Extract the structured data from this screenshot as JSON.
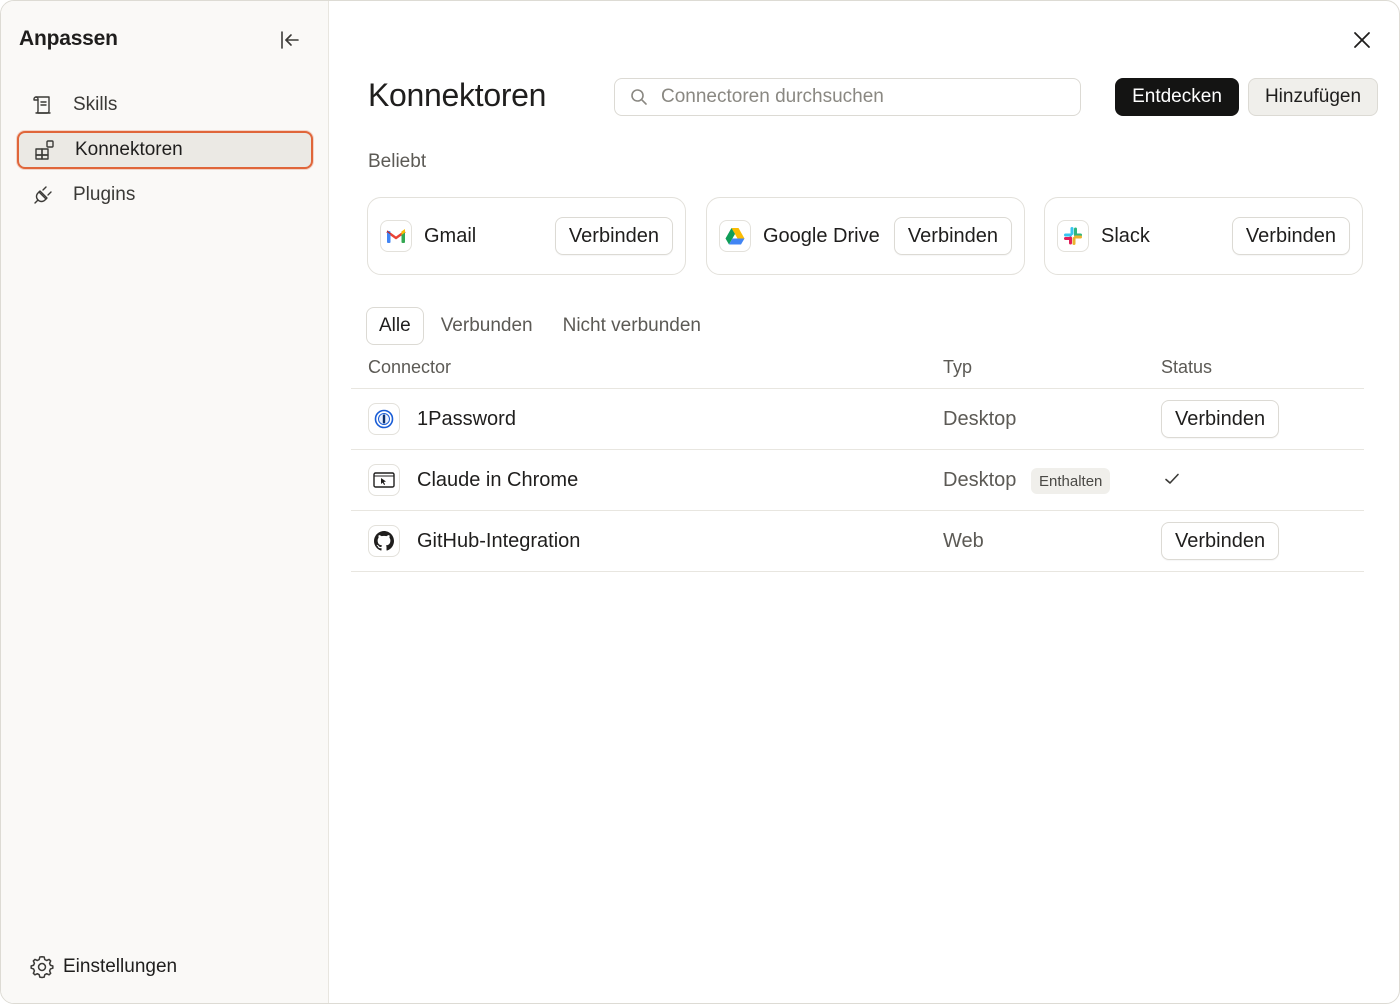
{
  "sidebar": {
    "title": "Anpassen",
    "items": [
      {
        "label": "Skills",
        "icon": "scroll-icon",
        "active": false
      },
      {
        "label": "Konnektoren",
        "icon": "connectors-icon",
        "active": true
      },
      {
        "label": "Plugins",
        "icon": "plug-icon",
        "active": false
      }
    ],
    "settings_label": "Einstellungen"
  },
  "main": {
    "title": "Konnektoren",
    "search_placeholder": "Connectoren durchsuchen",
    "discover_label": "Entdecken",
    "add_label": "Hinzufügen",
    "popular_label": "Beliebt",
    "popular": [
      {
        "name": "Gmail",
        "icon": "gmail-icon",
        "action": "Verbinden"
      },
      {
        "name": "Google Drive",
        "icon": "google-drive-icon",
        "action": "Verbinden"
      },
      {
        "name": "Slack",
        "icon": "slack-icon",
        "action": "Verbinden"
      }
    ],
    "tabs": [
      "Alle",
      "Verbunden",
      "Nicht verbunden"
    ],
    "active_tab": "Alle",
    "table": {
      "headers": [
        "Connector",
        "Typ",
        "Status"
      ],
      "rows": [
        {
          "name": "1Password",
          "icon": "1password-icon",
          "type": "Desktop",
          "badge": "",
          "status": "Verbinden"
        },
        {
          "name": "Claude in Chrome",
          "icon": "chrome-extension-icon",
          "type": "Desktop",
          "badge": "Enthalten",
          "status": "connected"
        },
        {
          "name": "GitHub-Integration",
          "icon": "github-icon",
          "type": "Web",
          "badge": "",
          "status": "Verbinden"
        }
      ]
    }
  },
  "colors": {
    "accent_outline": "#e0663a",
    "primary_button": "#141413",
    "sidebar_bg": "#faf9f7"
  }
}
